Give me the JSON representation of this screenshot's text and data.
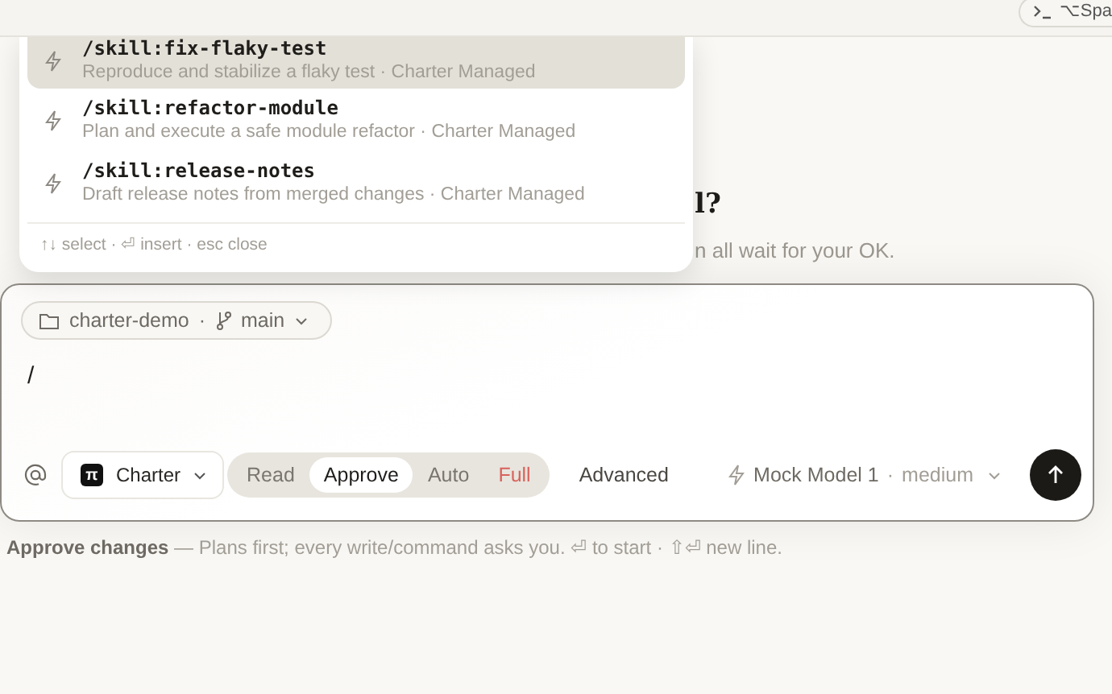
{
  "toolbar": {
    "shortcut_label": "⌥Spa"
  },
  "heading": {
    "title": "l?",
    "subtitle": "n all wait for your OK."
  },
  "popup": {
    "items": [
      {
        "command": "/skill:fix-flaky-test",
        "description": "Reproduce and stabilize a flaky test · Charter Managed",
        "selected": true
      },
      {
        "command": "/skill:refactor-module",
        "description": "Plan and execute a safe module refactor · Charter Managed",
        "selected": false
      },
      {
        "command": "/skill:release-notes",
        "description": "Draft release notes from merged changes · Charter Managed",
        "selected": false
      }
    ],
    "hint": "↑↓ select · ⏎ insert · esc close"
  },
  "composer": {
    "workspace": "charter-demo",
    "separator": "·",
    "branch": "main",
    "input_value": "/",
    "agent_logo": "π",
    "agent": "Charter",
    "modes": [
      {
        "label": "Read",
        "selected": false,
        "kind": "normal"
      },
      {
        "label": "Approve",
        "selected": true,
        "kind": "normal"
      },
      {
        "label": "Auto",
        "selected": false,
        "kind": "normal"
      },
      {
        "label": "Full",
        "selected": false,
        "kind": "danger"
      }
    ],
    "advanced": "Advanced",
    "model": "Mock Model 1",
    "effort": "medium"
  },
  "footer": {
    "text": "**Approve changes** — Plans first; every write/command asks you. ⏎ to start · ⇧⏎ new line."
  }
}
